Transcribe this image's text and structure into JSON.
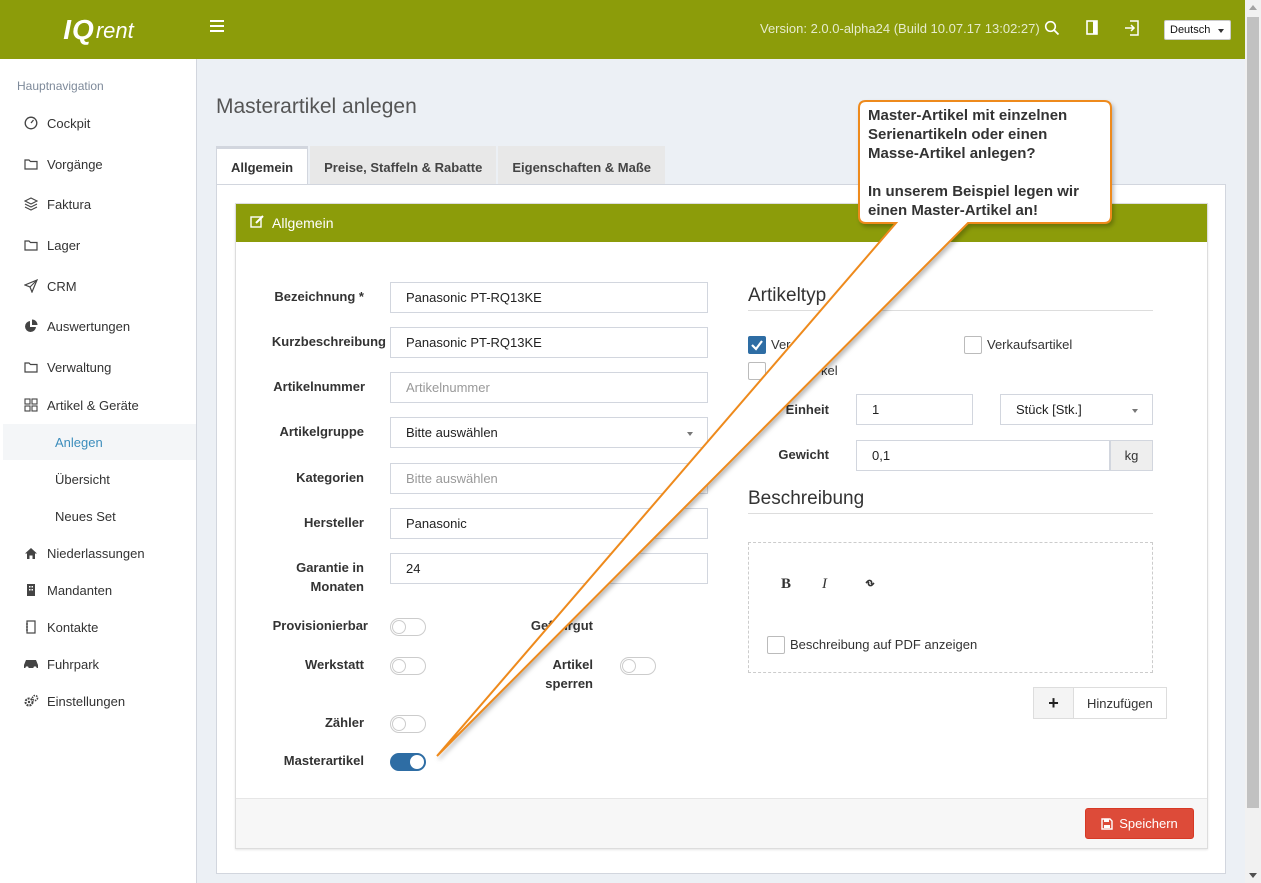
{
  "app": {
    "logo_a": "IQ",
    "logo_b": "rent",
    "version": "Version: 2.0.0-alpha24 (Build 10.07.17 13:02:27)",
    "language": "Deutsch",
    "top_icons": [
      "search-icon",
      "panel-icon",
      "logout-icon"
    ]
  },
  "sidebar": {
    "heading": "Hauptnavigation",
    "items": [
      {
        "label": "Cockpit",
        "icon": "gauge-icon"
      },
      {
        "label": "Vorgänge",
        "icon": "folder-icon"
      },
      {
        "label": "Faktura",
        "icon": "layers-icon"
      },
      {
        "label": "Lager",
        "icon": "folder-icon"
      },
      {
        "label": "CRM",
        "icon": "paper-plane-icon"
      },
      {
        "label": "Auswertungen",
        "icon": "pie-chart-icon"
      },
      {
        "label": "Verwaltung",
        "icon": "folder-icon"
      },
      {
        "label": "Artikel & Geräte",
        "icon": "grid-icon"
      },
      {
        "label": "Niederlassungen",
        "icon": "home-icon"
      },
      {
        "label": "Mandanten",
        "icon": "building-icon"
      },
      {
        "label": "Kontakte",
        "icon": "contact-book-icon"
      },
      {
        "label": "Fuhrpark",
        "icon": "car-icon"
      },
      {
        "label": "Einstellungen",
        "icon": "gears-icon"
      }
    ],
    "subitems": [
      {
        "label": "Anlegen",
        "active": true
      },
      {
        "label": "Übersicht",
        "active": false
      },
      {
        "label": "Neues Set",
        "active": false
      }
    ]
  },
  "page": {
    "title": "Masterartikel anlegen",
    "tabs": [
      "Allgemein",
      "Preise, Staffeln & Rabatte",
      "Eigenschaften & Maße"
    ],
    "active_tab": "Allgemein"
  },
  "panel": {
    "title": "Allgemein",
    "fields": {
      "bezeichnung": {
        "label": "Bezeichnung *",
        "value": "Panasonic PT-RQ13KE"
      },
      "kurzbeschreibung": {
        "label": "Kurzbeschreibung",
        "value": "Panasonic PT-RQ13KE"
      },
      "artikelnummer": {
        "label": "Artikelnummer",
        "placeholder": "Artikelnummer"
      },
      "artikelgruppe": {
        "label": "Artikelgruppe",
        "value": "Bitte auswählen"
      },
      "kategorien": {
        "label": "Kategorien",
        "placeholder": "Bitte auswählen"
      },
      "hersteller": {
        "label": "Hersteller",
        "value": "Panasonic"
      },
      "garantie_line1": "Garantie in",
      "garantie_line2": "Monaten",
      "garantie_value": "24"
    },
    "toggles": {
      "provisionierbar": {
        "label": "Provisionierbar",
        "on": false
      },
      "gefahrgut": {
        "label": "Gefahrgut",
        "on": false
      },
      "werkstatt": {
        "label": "Werkstatt",
        "on": false
      },
      "artikel_sperren_line1": "Artikel",
      "artikel_sperren_line2": "sperren",
      "artikel_sperren_on": false,
      "zaehler": {
        "label": "Zähler",
        "on": false
      },
      "masterartikel": {
        "label": "Masterartikel",
        "on": true
      }
    },
    "artikeltyp": {
      "title": "Artikeltyp",
      "checkbox1": {
        "label": "Ver",
        "checked": true
      },
      "checkbox2": {
        "label": "Verkaufsartikel",
        "checked": false
      },
      "checkbox3": {
        "label": "kel",
        "checked": false
      },
      "einheit_label": "Einheit",
      "einheit_value": "1",
      "einheit_unit": "Stück [Stk.]",
      "gewicht_label": "Gewicht",
      "gewicht_value": "0,1",
      "gewicht_unit": "kg"
    },
    "beschreibung": {
      "title": "Beschreibung",
      "bold": "B",
      "italic": "I",
      "pdf_checkbox_label": "Beschreibung auf PDF anzeigen",
      "pdf_checked": false,
      "add_button": "Hinzufügen",
      "add_symbol": "+"
    },
    "save_button": "Speichern"
  },
  "callout": {
    "line1": "Master-Artikel mit einzelnen",
    "line2": "Serienartikeln oder einen",
    "line3": "Masse-Artikel anlegen?",
    "line4": "In unserem Beispiel legen wir",
    "line5": "einen Master-Artikel an!"
  },
  "colors": {
    "brand_green": "#8c9c0a",
    "toggle_on": "#2e6da4",
    "save_red": "#dd4b39",
    "callout_border": "#ee8a1e"
  }
}
